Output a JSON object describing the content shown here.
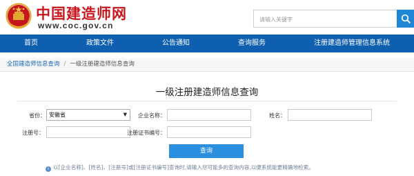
{
  "header": {
    "site_name": "中国建造师网",
    "site_url": "www.coc.gov.cn",
    "search_placeholder": "请输入关键字"
  },
  "nav": {
    "items": [
      "首页",
      "政策文件",
      "公告通知",
      "查询服务",
      "注册建造师管理信息系统"
    ]
  },
  "breadcrumb": {
    "home": "全国建造师信息查询",
    "separator": "/",
    "current": "一级注册建造师信息查询"
  },
  "main": {
    "title": "一级注册建造师信息查询",
    "province_label": "省份：",
    "province_value": "安徽省",
    "company_label": "企业名称：",
    "company_value": "",
    "name_label": "姓名：",
    "name_value": "",
    "reg_no_label": "注册号：",
    "reg_no_value": "",
    "cert_no_label": "注册证书编号：",
    "cert_no_value": "",
    "query_button": "查询",
    "note": "以[企业名称]、[姓名]、[注册号]或[注册证书编号]查询时,请输入尽可能多的查询内容,以便系统能更精确地检索。"
  },
  "colors": {
    "brand_red": "#c8161d",
    "nav_blue": "#0f5fb0",
    "button_blue": "#2b8fdf"
  },
  "icons": {
    "emblem": "national-emblem",
    "search": "search-icon",
    "select_caret": "caret-down-icon",
    "note": "info-icon"
  }
}
